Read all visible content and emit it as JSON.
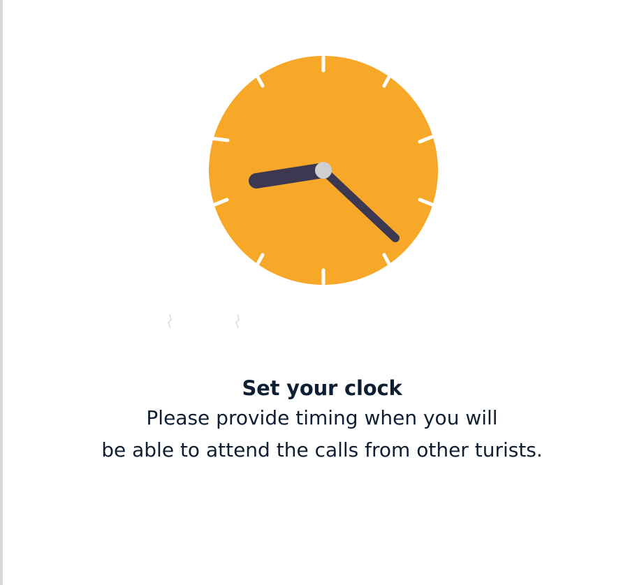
{
  "onboarding": {
    "title": "Set your clock",
    "description_line1": "Please provide timing when you will",
    "description_line2": "be able to attend the calls from other turists."
  },
  "illustration": {
    "icon": "clock-icon",
    "colors": {
      "face": "#f8a829",
      "hands": "#3d3852",
      "center": "#cfcfcf",
      "ticks": "#ffffff"
    }
  },
  "colors": {
    "text": "#0f1f33",
    "background": "#ffffff"
  }
}
